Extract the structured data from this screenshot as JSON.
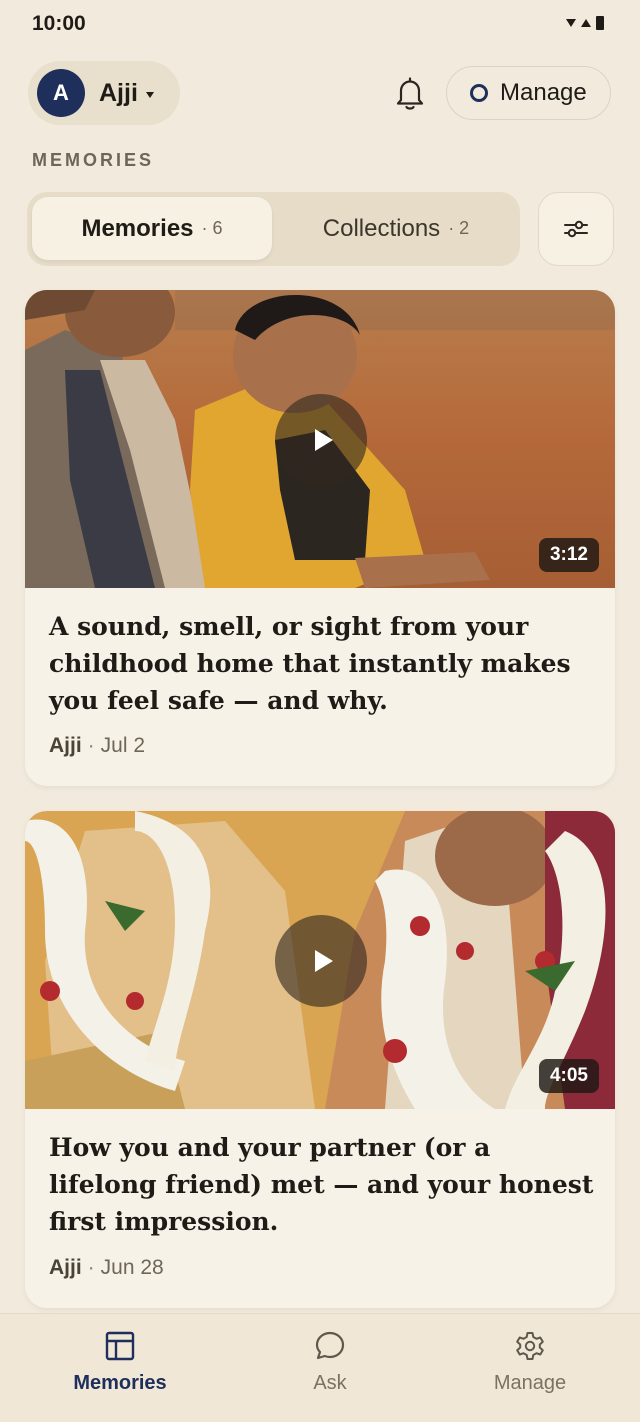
{
  "status_bar": {
    "time": "10:00"
  },
  "header": {
    "profile": {
      "initial": "A",
      "name": "Ajji"
    },
    "manage_label": "Manage",
    "icons": {
      "notifications": "bell-icon",
      "filter": "sliders-icon"
    }
  },
  "section_label": "MEMORIES",
  "segmented": {
    "tabs": [
      {
        "label": "Memories",
        "count": "· 6",
        "selected": true
      },
      {
        "label": "Collections",
        "count": "· 2",
        "selected": false
      }
    ]
  },
  "memories": [
    {
      "duration": "3:12",
      "title": "A sound, smell, or sight from your childhood home that instantly makes you feel safe — and why.",
      "author": "Ajji",
      "separator": "·",
      "date": "Jul 2"
    },
    {
      "duration": "4:05",
      "title": "How you and your partner (or a lifelong friend) met — and your honest first impression.",
      "author": "Ajji",
      "separator": "·",
      "date": "Jun 28"
    }
  ],
  "bottom_nav": {
    "items": [
      {
        "label": "Memories",
        "icon": "layout-icon",
        "active": true
      },
      {
        "label": "Ask",
        "icon": "chat-bubble-icon",
        "active": false
      },
      {
        "label": "Manage",
        "icon": "gear-icon",
        "active": false
      }
    ]
  },
  "colors": {
    "background": "#f2ebdd",
    "accent_navy": "#1e2f5b",
    "card": "#f7f2e7",
    "muted_text": "#6e6658"
  }
}
